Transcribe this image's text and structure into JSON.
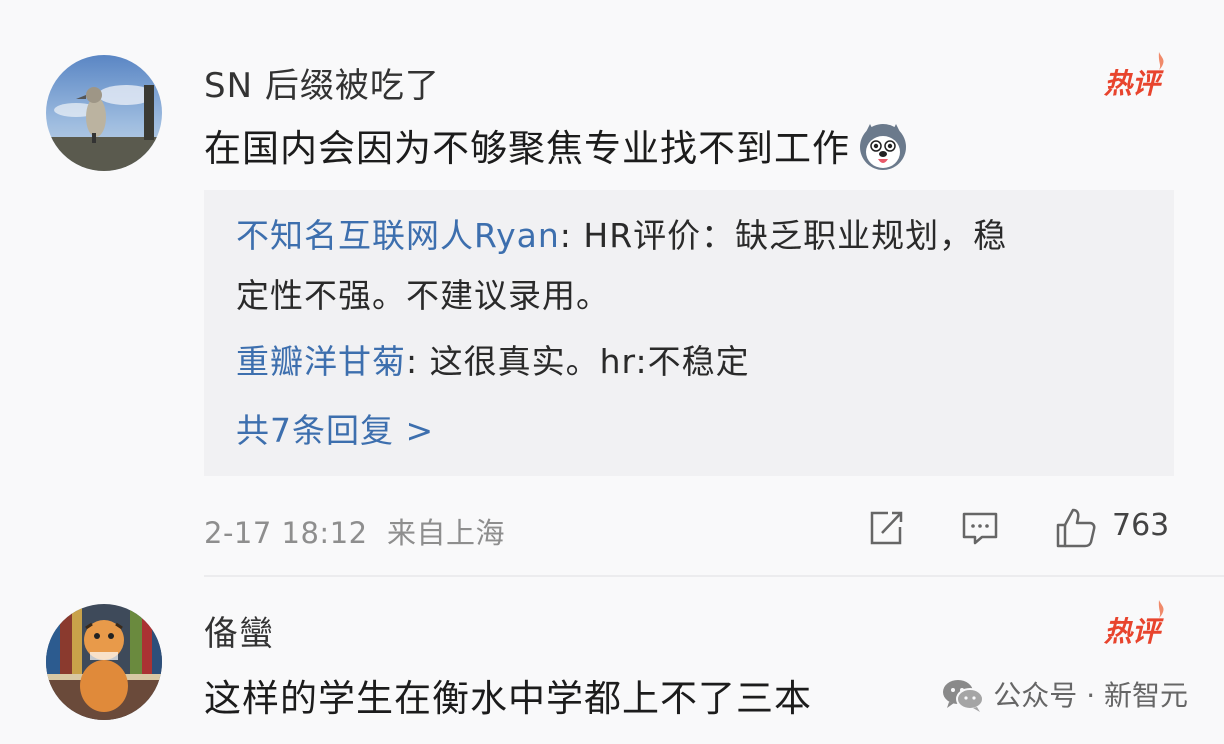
{
  "comment1": {
    "username": "SN 后缀被吃了",
    "badge": "热评",
    "text": "在国内会因为不够聚焦专业找不到工作",
    "emoji": "husky-emoji-icon",
    "replies": [
      {
        "name": "不知名互联网人Ryan",
        "text": ": HR评价：缺乏职业规划，稳",
        "text_line2": "定性不强。不建议录用。"
      },
      {
        "name": "重瓣洋甘菊",
        "text": ": 这很真实。hr:不稳定"
      }
    ],
    "more_replies": "共7条回复 >",
    "date": "2-17 18:12",
    "location": "来自上海",
    "like_count": "763"
  },
  "comment2": {
    "username": "俻蠻",
    "badge": "热评",
    "text": "这样的学生在衡水中学都上不了三本"
  },
  "watermark": {
    "text": "公众号 · 新智元",
    "icon": "wechat-icon"
  },
  "colors": {
    "link_blue": "#3d6fae",
    "hot_red": "#e8442d",
    "meta_gray": "#8e8e8e"
  }
}
